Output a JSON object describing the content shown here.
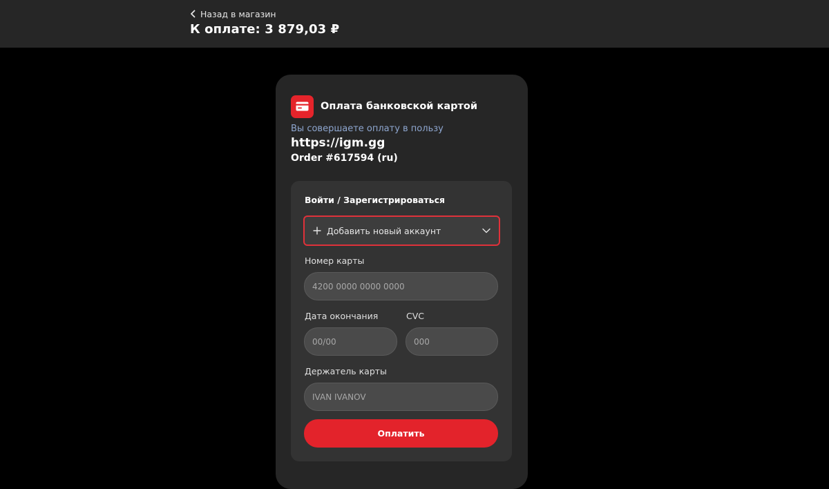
{
  "header": {
    "back_label": "Назад в магазин",
    "amount_title": "К оплате: 3 879,03 ₽"
  },
  "payment": {
    "method_title": "Оплата банковской картой",
    "payee_note": "Вы совершаете оплату в пользу",
    "payee_url": "https://igm.gg",
    "order": "Order #617594 (ru)"
  },
  "form": {
    "login_label": "Войти / Зарегистрироваться",
    "account_select": "Добавить новый аккаунт",
    "card_number_label": "Номер карты",
    "card_number_placeholder": "4200 0000 0000 0000",
    "expiry_label": "Дата окончания",
    "expiry_placeholder": "00/00",
    "cvc_label": "CVC",
    "cvc_placeholder": "000",
    "holder_label": "Держатель карты",
    "holder_placeholder": "IVAN IVANOV",
    "pay_button": "Оплатить"
  },
  "colors": {
    "accent": "#e3232b",
    "link_blue": "#8ea6cf",
    "panel": "#333333",
    "card": "#262626"
  },
  "icons": {
    "back": "chevron-left-icon",
    "method": "credit-card-icon",
    "add": "plus-icon",
    "dropdown": "chevron-down-icon"
  }
}
